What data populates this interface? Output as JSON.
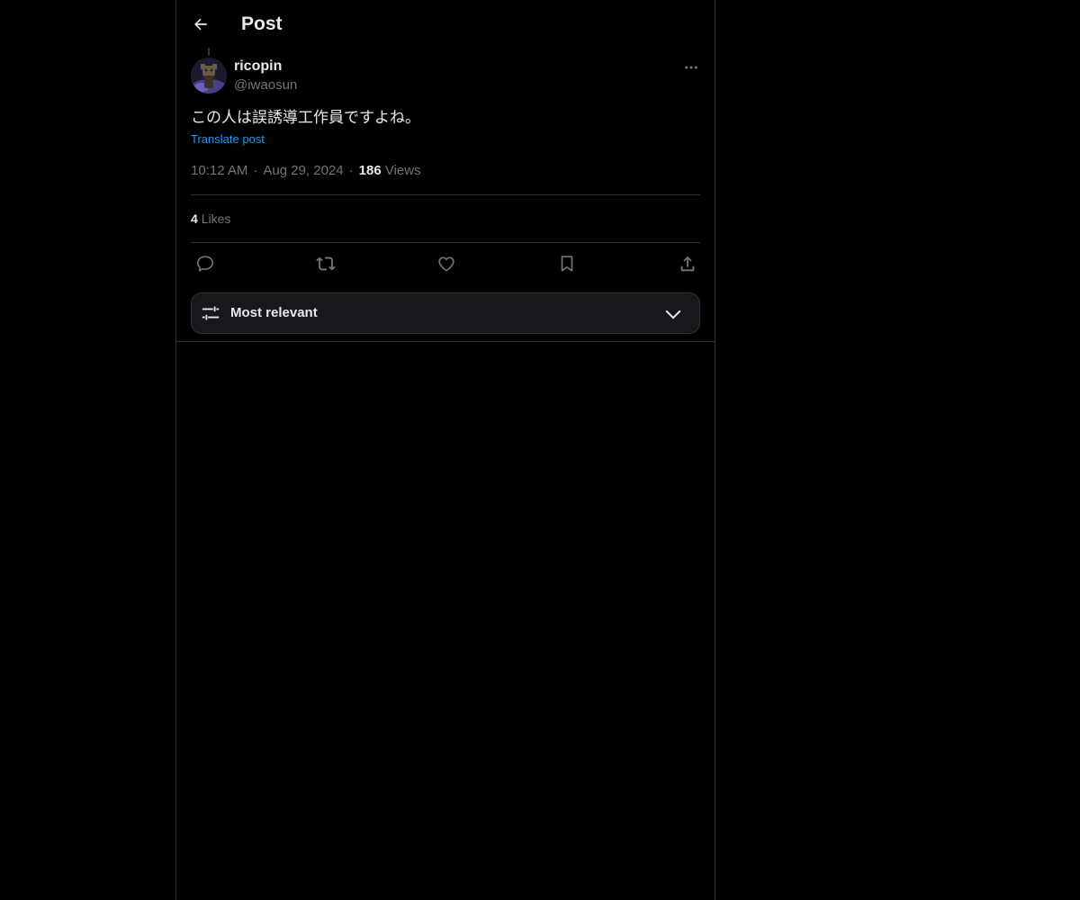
{
  "header": {
    "title": "Post",
    "back_icon": "arrow-left-icon"
  },
  "post": {
    "author": {
      "display_name": "ricopin",
      "handle": "@iwaosun"
    },
    "text": "この人は誤誘導工作員ですよね。",
    "translate_label": "Translate post",
    "time": "10:12 AM",
    "date": "Aug 29, 2024",
    "separator": "·",
    "views_count": "186",
    "views_label": "Views",
    "likes_count": "4",
    "likes_label": "Likes"
  },
  "actions": {
    "icons": [
      "reply-icon",
      "repost-icon",
      "like-icon",
      "bookmark-icon",
      "share-icon"
    ]
  },
  "sort": {
    "label": "Most relevant",
    "icon": "sliders-icon"
  },
  "colors": {
    "background": "#000000",
    "text_primary": "#e7e9ea",
    "text_secondary": "#71767b",
    "link": "#1d9bf0",
    "border": "#2f3336"
  }
}
